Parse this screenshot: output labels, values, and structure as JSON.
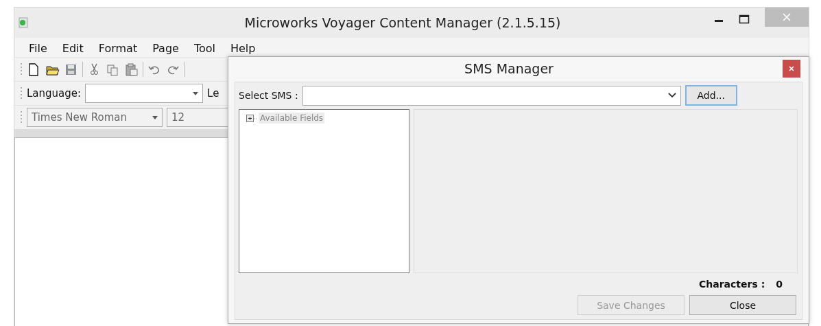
{
  "window": {
    "title": "Microworks Voyager Content Manager (2.1.5.15)"
  },
  "menu": [
    {
      "label": "File"
    },
    {
      "label": "Edit"
    },
    {
      "label": "Format"
    },
    {
      "label": "Page"
    },
    {
      "label": "Tool"
    },
    {
      "label": "Help"
    }
  ],
  "language_bar": {
    "label": "Language:",
    "next_label": "Le"
  },
  "font_bar": {
    "font": "Times New Roman",
    "size": "12"
  },
  "dialog": {
    "title": "SMS Manager",
    "select_label": "Select SMS :",
    "add_button": "Add...",
    "tree": [
      {
        "label": "Available Fields",
        "expanded": false
      }
    ],
    "characters_label": "Characters :",
    "characters_value": "0",
    "buttons": [
      {
        "label": "Save Changes",
        "disabled": true
      },
      {
        "label": "Close",
        "disabled": false
      }
    ]
  }
}
